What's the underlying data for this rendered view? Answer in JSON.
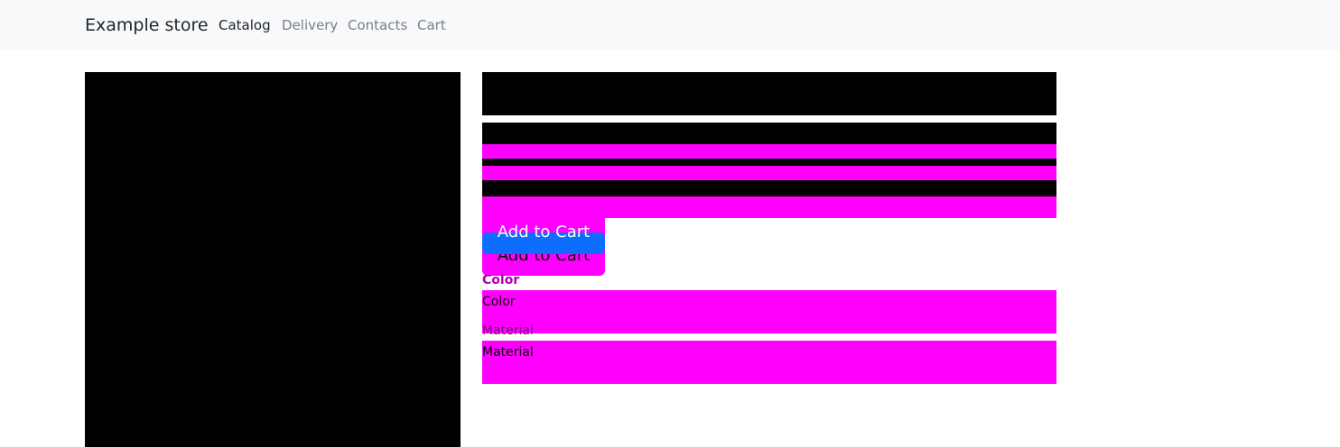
{
  "navbar": {
    "brand": "Example store",
    "links": [
      {
        "label": "Catalog",
        "active": true
      },
      {
        "label": "Delivery",
        "active": false
      },
      {
        "label": "Contacts",
        "active": false
      },
      {
        "label": "Cart",
        "active": false
      }
    ]
  },
  "product": {
    "add_to_cart_label": "Add to Cart",
    "add_to_cart_label_overlay": "Add to Cart",
    "options": {
      "color_heading": "Color",
      "color_label": "Color",
      "material_heading": "Material",
      "material_label": "Material"
    }
  },
  "colors": {
    "placeholder_magenta": "#ff00ff",
    "placeholder_black": "#000000",
    "primary_button": "#0d6efd",
    "navbar_bg": "#f8f9fa"
  }
}
